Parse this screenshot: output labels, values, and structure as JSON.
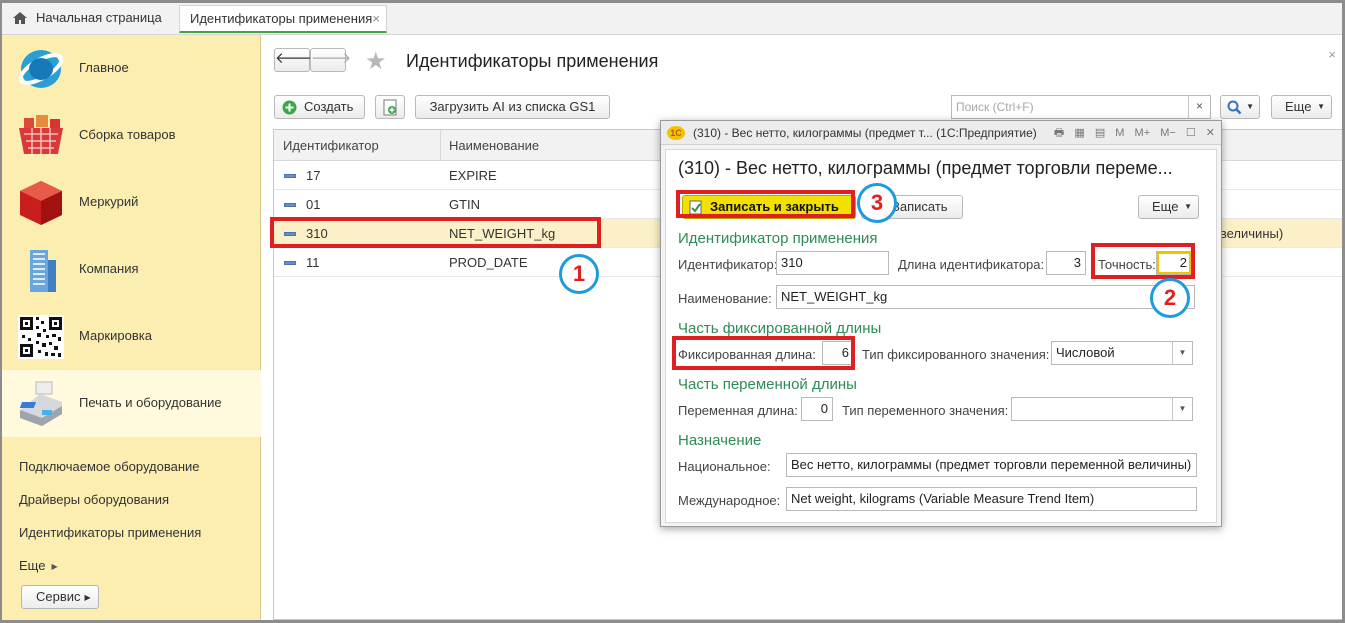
{
  "tabs": {
    "home_label": "Начальная страница",
    "active_label": "Идентификаторы применения",
    "close_glyph": "×"
  },
  "sidebar": {
    "sections": [
      {
        "label": "Главное"
      },
      {
        "label": "Сборка товаров"
      },
      {
        "label": "Меркурий"
      },
      {
        "label": "Компания"
      },
      {
        "label": "Маркировка"
      },
      {
        "label": "Печать и оборудование"
      }
    ],
    "subitems": [
      {
        "label": "Подключаемое оборудование"
      },
      {
        "label": "Драйверы оборудования"
      },
      {
        "label": "Идентификаторы применения"
      },
      {
        "label": "Еще"
      }
    ],
    "servis_label": "Сервис"
  },
  "main": {
    "title": "Идентификаторы применения",
    "close_glyph": "×",
    "toolbar": {
      "create_label": "Создать",
      "load_label": "Загрузить AI из списка GS1",
      "search_placeholder": "Поиск (Ctrl+F)",
      "search_clear": "×",
      "more_label": "Еще"
    },
    "table": {
      "columns": [
        "Идентификатор",
        "Наименование"
      ],
      "rows": [
        {
          "id": "17",
          "name": "EXPIRE"
        },
        {
          "id": "01",
          "name": "GTIN"
        },
        {
          "id": "310",
          "name": "NET_WEIGHT_kg",
          "trail": "й величины)"
        },
        {
          "id": "11",
          "name": "PROD_DATE"
        }
      ]
    }
  },
  "dialog": {
    "window_title": "(310) - Вес нетто, килограммы (предмет т...  (1С:Предприятие)",
    "window_tools": [
      "М",
      "М+",
      "М−"
    ],
    "heading": "(310) - Вес нетто, килограммы (предмет торговли переме...",
    "save_close_label": "Записать и закрыть",
    "save_label": "Записать",
    "more_label": "Еще",
    "group_id": "Идентификатор применения",
    "id_label": "Идентификатор:",
    "id_value": "310",
    "id_len_label": "Длина идентификатора:",
    "id_len_value": "3",
    "precision_label": "Точность:",
    "precision_value": "2",
    "name_label": "Наименование:",
    "name_value": "NET_WEIGHT_kg",
    "group_fixed": "Часть фиксированной длины",
    "fixed_len_label": "Фиксированная длина:",
    "fixed_len_value": "6",
    "fixed_type_label": "Тип фиксированного значения:",
    "fixed_type_value": "Числовой",
    "group_var": "Часть переменной длины",
    "var_len_label": "Переменная длина:",
    "var_len_value": "0",
    "var_type_label": "Тип переменного значения:",
    "var_type_value": "",
    "group_purpose": "Назначение",
    "national_label": "Национальное:",
    "national_value": "Вес нетто, килограммы (предмет торговли переменной величины)",
    "international_label": "Международное:",
    "international_value": "Net weight, kilograms (Variable Measure Trend Item)"
  },
  "annotations": {
    "b1": "1",
    "b2": "2",
    "b3": "3",
    "color": "#e02020",
    "circle_color": "#1e9be0"
  }
}
